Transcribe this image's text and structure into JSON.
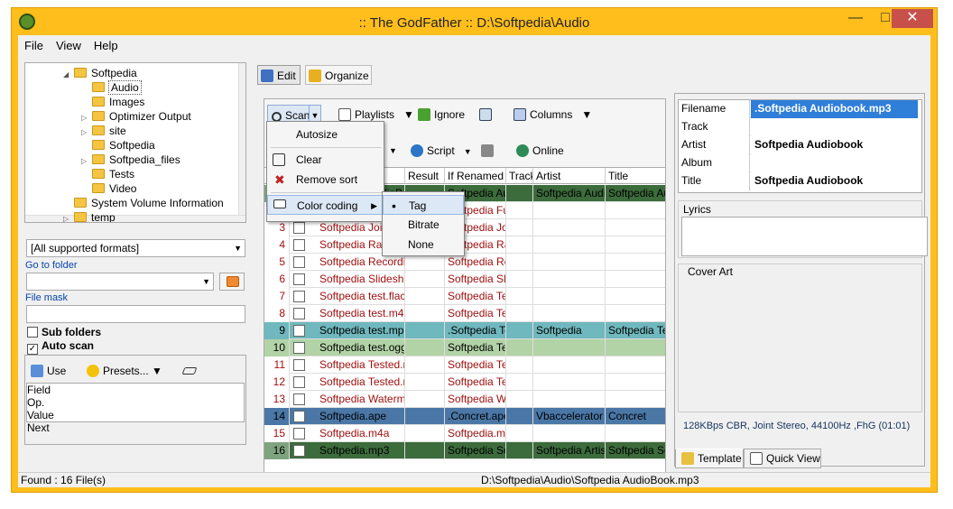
{
  "window": {
    "title": ":: The GodFather ::  D:\\Softpedia\\Audio"
  },
  "menu": [
    "File",
    "View",
    "Help"
  ],
  "tree": [
    {
      "label": "Softpedia",
      "indent": 62,
      "exp": "◢"
    },
    {
      "label": "Audio",
      "indent": 82,
      "exp": "",
      "selected": true
    },
    {
      "label": "Images",
      "indent": 82,
      "exp": ""
    },
    {
      "label": "Optimizer Output",
      "indent": 82,
      "exp": "▷"
    },
    {
      "label": "site",
      "indent": 82,
      "exp": "▷"
    },
    {
      "label": "Softpedia",
      "indent": 82,
      "exp": ""
    },
    {
      "label": "Softpedia_files",
      "indent": 82,
      "exp": "▷"
    },
    {
      "label": "Tests",
      "indent": 82,
      "exp": ""
    },
    {
      "label": "Video",
      "indent": 82,
      "exp": ""
    },
    {
      "label": "System Volume Information",
      "indent": 62,
      "exp": ""
    },
    {
      "label": "temp",
      "indent": 62,
      "exp": "▷"
    }
  ],
  "left": {
    "format": "[All supported formats]",
    "go_to_folder": "Go to folder",
    "file_mask": "File mask",
    "sub_folders": "Sub folders",
    "auto_scan": "Auto scan",
    "use": "Use",
    "presets": "Presets...",
    "grid_headers": [
      "Field",
      "Op.",
      "Value",
      "Next"
    ]
  },
  "tabs": {
    "edit": "Edit",
    "organize": "Organize"
  },
  "toolbar": {
    "scan": "Scan",
    "playlists": "Playlists",
    "ignore": "Ignore",
    "columns": "Columns",
    "script": "Script",
    "online": "Online"
  },
  "scan_menu": {
    "items": [
      "Autosize",
      "Clear",
      "Remove sort",
      "Color coding"
    ],
    "sub": [
      "Tag",
      "Bitrate",
      "None"
    ]
  },
  "columns": [
    "Result",
    "If Renamed",
    "Track",
    "Artist",
    "Title"
  ],
  "rows": [
    {
      "n": "1",
      "file": "Softpedia AudioBoo",
      "ren": "Softpedia Au",
      "artist": "Softpedia Audio",
      "title": "Softpedia Au",
      "style": "green"
    },
    {
      "n": "2",
      "file": "Softpedia Full",
      "ren": "Softpedia Ful",
      "artist": "",
      "title": "",
      "style": "red"
    },
    {
      "n": "3",
      "file": "Softpedia Joined",
      "ren": "Softpedia Join",
      "artist": "",
      "title": "",
      "style": "red"
    },
    {
      "n": "4",
      "file": "Softpedia Radio",
      "ren": "Softpedia Rad",
      "artist": "",
      "title": "",
      "style": "red"
    },
    {
      "n": "5",
      "file": "Softpedia Recording",
      "ren": "Softpedia Rec",
      "artist": "",
      "title": "",
      "style": "red"
    },
    {
      "n": "6",
      "file": "Softpedia Slideshow",
      "ren": "Softpedia Slic",
      "artist": "",
      "title": "",
      "style": "red"
    },
    {
      "n": "7",
      "file": "Softpedia test.flac",
      "ren": "Softpedia Tes",
      "artist": "",
      "title": "",
      "style": "red"
    },
    {
      "n": "8",
      "file": "Softpedia test.m4a",
      "ren": "Softpedia Tes",
      "artist": "",
      "title": "",
      "style": "red"
    },
    {
      "n": "9",
      "file": "Softpedia test.mp3",
      "ren": ".Softpedia Te",
      "artist": "Softpedia",
      "title": "Softpedia Tes",
      "style": "teal"
    },
    {
      "n": "10",
      "file": "Softpedia test.ogg",
      "ren": "Softpedia Tes",
      "artist": "",
      "title": "",
      "style": "lightgreen"
    },
    {
      "n": "11",
      "file": "Softpedia Tested.mp3",
      "ren": "Softpedia Tes",
      "artist": "",
      "title": "",
      "style": "red"
    },
    {
      "n": "12",
      "file": "Softpedia Tested.m4a",
      "ren": "Softpedia Tes",
      "artist": "",
      "title": "",
      "style": "red"
    },
    {
      "n": "13",
      "file": "Softpedia Watermark",
      "ren": "Softpedia Wa",
      "artist": "",
      "title": "",
      "style": "red"
    },
    {
      "n": "14",
      "file": "Softpedia.ape",
      "ren": ".Concret.ape",
      "artist": "Vbaccelerator",
      "title": "Concret",
      "style": "blue"
    },
    {
      "n": "15",
      "file": "Softpedia.m4a",
      "ren": "Softpedia.m4",
      "artist": "",
      "title": "",
      "style": "red"
    },
    {
      "n": "16",
      "file": "Softpedia.mp3",
      "ren": "Softpedia So",
      "artist": "Softpedia Artist",
      "title": "Softpedia So",
      "style": "green"
    }
  ],
  "tags": [
    {
      "k": "Filename",
      "v": ".Softpedia Audiobook.mp3",
      "hl": true
    },
    {
      "k": "Track",
      "v": ""
    },
    {
      "k": "Artist",
      "v": "Softpedia Audiobook"
    },
    {
      "k": "Album",
      "v": ""
    },
    {
      "k": "Title",
      "v": "Softpedia Audiobook"
    }
  ],
  "right": {
    "lyrics": "Lyrics",
    "cover": "Cover Art",
    "info": "128KBps CBR, Joint Stereo, 44100Hz ,FhG (01:01)",
    "tab_template": "Template",
    "tab_quick": "Quick View"
  },
  "status": {
    "found": "Found : 16 File(s)",
    "path": "D:\\Softpedia\\Audio\\Softpedia AudioBook.mp3"
  }
}
